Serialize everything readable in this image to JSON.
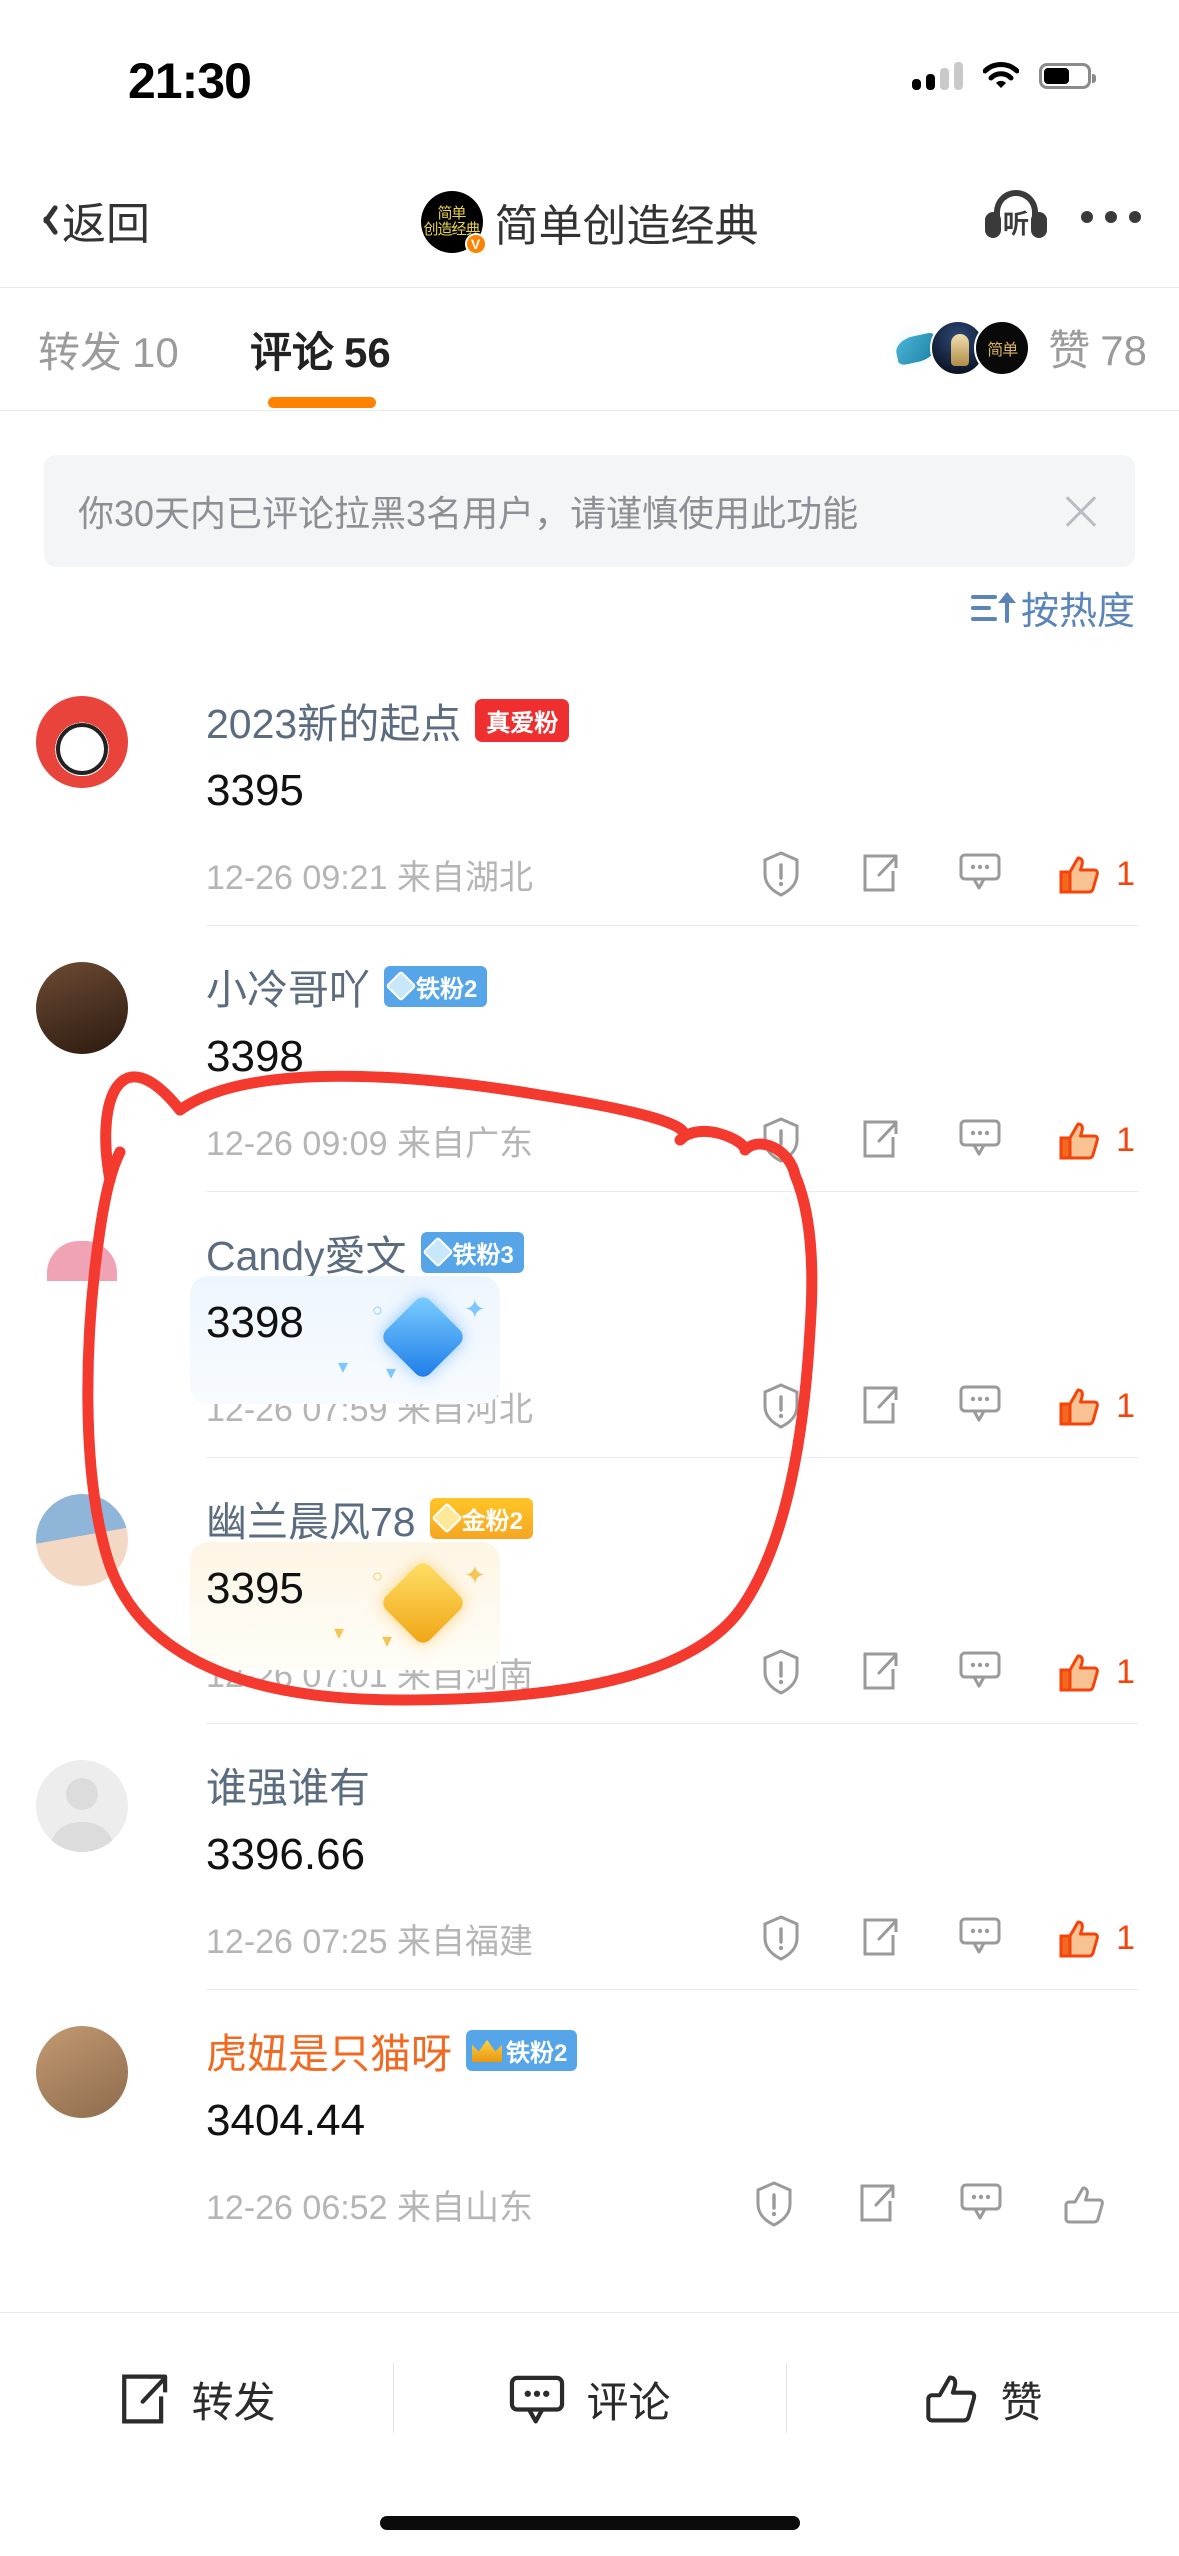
{
  "status_bar": {
    "time": "21:30",
    "icons": [
      "cellular-signal-icon",
      "wifi-icon",
      "battery-icon"
    ]
  },
  "nav": {
    "back_label": "返回",
    "account_avatar_text": "简单\n创造经典",
    "verified_mark": "V",
    "title": "简单创造经典",
    "listen_label": "听",
    "more_label": "•••"
  },
  "tabs": [
    {
      "label": "转发",
      "count": "10",
      "active": false
    },
    {
      "label": "评论",
      "count": "56",
      "active": true
    }
  ],
  "likes": {
    "label": "赞",
    "count": "78",
    "avatars": [
      "shark-avatar",
      "character-avatar",
      "jiandan-avatar"
    ]
  },
  "notice": {
    "text": "你30天内已评论拉黑3名用户，请谨慎使用此功能",
    "close_label": "×"
  },
  "sort": {
    "label": "按热度"
  },
  "comments": [
    {
      "name": "2023新的起点",
      "name_color": "#5b6b80",
      "badge": {
        "text": "真爱粉",
        "style": "red",
        "icon": ""
      },
      "text": "3395",
      "sticker": "none",
      "time": "12-26 09:21",
      "location": "来自湖北",
      "liked": true,
      "like_count": "1"
    },
    {
      "name": "小冷哥吖",
      "name_color": "#5b6b80",
      "badge": {
        "text": "铁粉2",
        "style": "blue",
        "icon": "gem"
      },
      "text": "3398",
      "sticker": "none",
      "time": "12-26 09:09",
      "location": "来自广东",
      "liked": true,
      "like_count": "1"
    },
    {
      "name": "Candy愛文",
      "name_color": "#5b6b80",
      "badge": {
        "text": "铁粉3",
        "style": "blue",
        "icon": "gem"
      },
      "text": "3398",
      "sticker": "blue-diamond",
      "time": "12-26 07:59",
      "location": "来自河北",
      "liked": true,
      "like_count": "1"
    },
    {
      "name": "幽兰晨风78",
      "name_color": "#5b6b80",
      "badge": {
        "text": "金粉2",
        "style": "gold",
        "icon": "gem-gold"
      },
      "text": "3395",
      "sticker": "gold-diamond",
      "time": "12-26 07:01",
      "location": "来自河南",
      "liked": true,
      "like_count": "1"
    },
    {
      "name": "谁强谁有",
      "name_color": "#5b6b80",
      "badge": null,
      "text": "3396.66",
      "sticker": "none",
      "time": "12-26 07:25",
      "location": "来自福建",
      "liked": true,
      "like_count": "1"
    },
    {
      "name": "虎妞是只猫呀",
      "name_color": "#f26a21",
      "badge": {
        "text": "铁粉2",
        "style": "blue",
        "icon": "crown"
      },
      "text": "3404.44",
      "sticker": "none",
      "time": "12-26 06:52",
      "location": "来自山东",
      "liked": false,
      "like_count": ""
    }
  ],
  "bottom_bar": [
    {
      "label": "转发",
      "icon": "share-icon"
    },
    {
      "label": "评论",
      "icon": "comment-icon"
    },
    {
      "label": "赞",
      "icon": "thumbs-up-icon"
    }
  ],
  "annotation": {
    "type": "hand-drawn-red-circle",
    "color": "#f4392f",
    "targets": "third-comment"
  },
  "colors": {
    "accent_orange": "#ff8200",
    "like_red": "#f5440b",
    "badge_red": "#ef2f2f",
    "badge_blue": "#56a5e8",
    "badge_gold": "#f5a623",
    "link_blue": "#5b85b8",
    "annotation_red": "#f4392f"
  }
}
